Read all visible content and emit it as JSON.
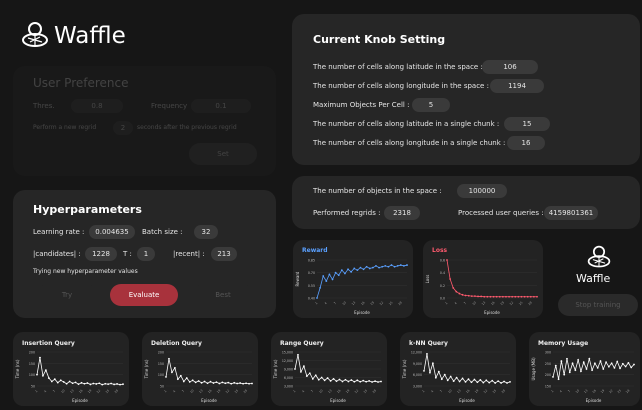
{
  "brand": {
    "name": "Waffle",
    "icon": "waffle-cone-icon"
  },
  "user_preference": {
    "title": "User Preference",
    "threshold_label": "Thres.",
    "threshold_value": "0.8",
    "frequency_label": "Frequency",
    "frequency_value": "0.1",
    "regrid_prefix": "Perform a new regrid",
    "regrid_value": "2",
    "regrid_suffix": "seconds after the previous regrid",
    "set_label": "Set"
  },
  "hyperparameters": {
    "title": "Hyperparameters",
    "learning_rate_label": "Learning rate :",
    "learning_rate_value": "0.004635",
    "batch_size_label": "Batch size :",
    "batch_size_value": "32",
    "candidates_label": "|candidates| :",
    "candidates_value": "1228",
    "t_label": "T :",
    "t_value": "1",
    "recent_label": "|recent| :",
    "recent_value": "213",
    "status": "Trying new hyperparameter values",
    "try_label": "Try",
    "evaluate_label": "Evaluate",
    "best_label": "Best"
  },
  "knob": {
    "title": "Current Knob Setting",
    "rows": [
      {
        "label": "The number of cells along latitude in the space :",
        "value": "106"
      },
      {
        "label": "The number of cells along longitude in the space :",
        "value": "1194"
      },
      {
        "label": "Maximum Objects Per Cell :",
        "value": "5"
      },
      {
        "label": "The number of cells along latitude in a single chunk :",
        "value": "15"
      },
      {
        "label": "The number of cells along longitude in a single chunk :",
        "value": "16"
      }
    ]
  },
  "stats": {
    "objects_label": "The number of objects in the space :",
    "objects_value": "100000",
    "regrids_label": "Performed regrids :",
    "regrids_value": "2318",
    "queries_label": "Processed user queries :",
    "queries_value": "4159801361"
  },
  "stop_training_label": "Stop training",
  "colors": {
    "reward": "#5aa0ff",
    "loss": "#ff5a6e",
    "evaluate": "#a8323c",
    "panel": "#262626"
  },
  "chart_data": [
    {
      "type": "line",
      "title": "Reward",
      "xlabel": "Episode",
      "ylabel": "Reward",
      "y_ticks": [
        "0.85",
        "0.70",
        "0.55",
        "0.40"
      ],
      "x": [
        1,
        2,
        3,
        4,
        5,
        6,
        7,
        8,
        9,
        10,
        11,
        12,
        13,
        14,
        15,
        16,
        17,
        18,
        19,
        20,
        21,
        22,
        23,
        24,
        25,
        26,
        27,
        28,
        29,
        30
      ],
      "values": [
        0.4,
        0.52,
        0.66,
        0.6,
        0.68,
        0.62,
        0.7,
        0.67,
        0.73,
        0.69,
        0.74,
        0.71,
        0.75,
        0.73,
        0.76,
        0.74,
        0.77,
        0.75,
        0.76,
        0.78,
        0.76,
        0.77,
        0.78,
        0.77,
        0.79,
        0.77,
        0.78,
        0.79,
        0.78,
        0.79
      ]
    },
    {
      "type": "line",
      "title": "Loss",
      "xlabel": "Episode",
      "ylabel": "Loss",
      "y_ticks": [
        "0.6",
        "0.4",
        "0.2",
        "0.0"
      ],
      "x": [
        1,
        2,
        3,
        4,
        5,
        6,
        7,
        8,
        9,
        10,
        11,
        12,
        13,
        14,
        15,
        16,
        17,
        18,
        19,
        20,
        21,
        22,
        23,
        24,
        25,
        26,
        27,
        28,
        29,
        30
      ],
      "values": [
        0.6,
        0.3,
        0.16,
        0.1,
        0.07,
        0.05,
        0.04,
        0.035,
        0.03,
        0.03,
        0.025,
        0.025,
        0.02,
        0.02,
        0.02,
        0.02,
        0.02,
        0.02,
        0.02,
        0.02,
        0.02,
        0.02,
        0.02,
        0.02,
        0.02,
        0.02,
        0.02,
        0.02,
        0.02,
        0.02
      ]
    },
    {
      "type": "line",
      "title": "Insertion Query",
      "xlabel": "Episode",
      "ylabel": "Time (ns)",
      "y_ticks": [
        "200",
        "150",
        "100",
        "50"
      ],
      "x": [
        1,
        2,
        3,
        4,
        5,
        6,
        7,
        8,
        9,
        10,
        11,
        12,
        13,
        14,
        15,
        16,
        17,
        18,
        19,
        20,
        21,
        22,
        23,
        24,
        25,
        26,
        27,
        28,
        29,
        30
      ],
      "values": [
        100,
        175,
        95,
        120,
        85,
        70,
        80,
        65,
        75,
        68,
        60,
        70,
        62,
        66,
        58,
        64,
        60,
        63,
        57,
        61,
        59,
        62,
        56,
        60,
        58,
        61,
        57,
        59,
        56,
        58
      ]
    },
    {
      "type": "line",
      "title": "Deletion Query",
      "xlabel": "Episode",
      "ylabel": "Time (ns)",
      "y_ticks": [
        "200",
        "150",
        "100",
        "50"
      ],
      "x": [
        1,
        2,
        3,
        4,
        5,
        6,
        7,
        8,
        9,
        10,
        11,
        12,
        13,
        14,
        15,
        16,
        17,
        18,
        19,
        20,
        21,
        22,
        23,
        24,
        25,
        26,
        27,
        28,
        29,
        30
      ],
      "values": [
        90,
        170,
        110,
        130,
        80,
        95,
        70,
        85,
        68,
        75,
        66,
        72,
        64,
        70,
        62,
        69,
        63,
        67,
        61,
        66,
        62,
        65,
        60,
        64,
        61,
        63,
        60,
        62,
        60,
        61
      ]
    },
    {
      "type": "line",
      "title": "Range Query",
      "xlabel": "Episode",
      "ylabel": "Time (ns)",
      "y_ticks": [
        "15,000",
        "12,000",
        "9,000",
        "6,000",
        "3,000"
      ],
      "x": [
        1,
        2,
        3,
        4,
        5,
        6,
        7,
        8,
        9,
        10,
        11,
        12,
        13,
        14,
        15,
        16,
        17,
        18,
        19,
        20,
        21,
        22,
        23,
        24,
        25,
        26,
        27,
        28,
        29,
        30
      ],
      "values": [
        9000,
        14000,
        8000,
        10000,
        6500,
        7500,
        5500,
        6800,
        5200,
        6000,
        5000,
        5800,
        4800,
        5500,
        4700,
        5300,
        4600,
        5200,
        4600,
        5100,
        4500,
        5000,
        4500,
        4900,
        4500,
        4800,
        4400,
        4700,
        4400,
        4600
      ]
    },
    {
      "type": "line",
      "title": "k-NN Query",
      "xlabel": "Episode",
      "ylabel": "Time (ns)",
      "y_ticks": [
        "12,000",
        "9,000",
        "6,000",
        "3,000"
      ],
      "x": [
        1,
        2,
        3,
        4,
        5,
        6,
        7,
        8,
        9,
        10,
        11,
        12,
        13,
        14,
        15,
        16,
        17,
        18,
        19,
        20,
        21,
        22,
        23,
        24,
        25,
        26,
        27,
        28,
        29,
        30
      ],
      "values": [
        7000,
        11500,
        6500,
        9000,
        5200,
        6800,
        4800,
        6000,
        4500,
        5500,
        4300,
        5200,
        4200,
        5000,
        4100,
        4800,
        4000,
        4700,
        4000,
        4600,
        3900,
        4500,
        3900,
        4400,
        3800,
        4300,
        3800,
        4200,
        3800,
        4100
      ]
    },
    {
      "type": "line",
      "title": "Memory Usage",
      "xlabel": "Episode",
      "ylabel": "Usage (MB)",
      "y_ticks": [
        "300",
        "250",
        "200",
        "150"
      ],
      "x": [
        1,
        2,
        3,
        4,
        5,
        6,
        7,
        8,
        9,
        10,
        11,
        12,
        13,
        14,
        15,
        16,
        17,
        18,
        19,
        20,
        21,
        22,
        23,
        24,
        25,
        26,
        27,
        28,
        29,
        30
      ],
      "values": [
        190,
        240,
        180,
        260,
        200,
        270,
        210,
        250,
        220,
        265,
        215,
        255,
        225,
        270,
        220,
        250,
        230,
        260,
        225,
        255,
        235,
        250,
        230,
        258,
        228,
        248,
        236,
        252,
        232,
        245
      ]
    }
  ]
}
